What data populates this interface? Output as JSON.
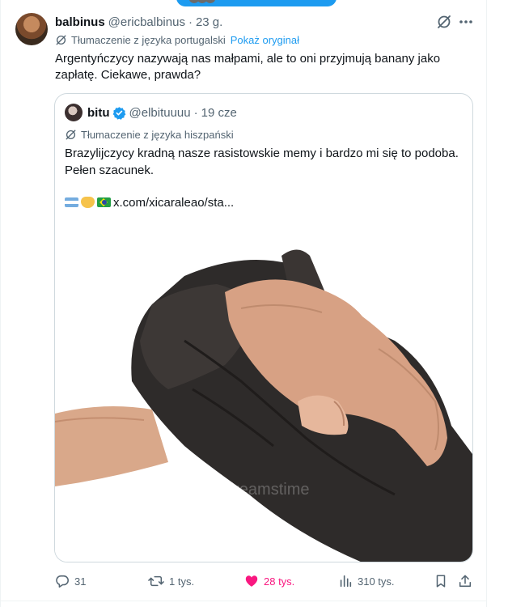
{
  "tweet": {
    "author_name": "balbinus",
    "author_handle": "@ericbalbinus",
    "separator": "·",
    "time": "23 g.",
    "translation_note": "Tłumaczenie z języka portugalski",
    "show_original": "Pokaż oryginał",
    "text": "Argentyńczycy nazywają nas małpami, ale to oni przyjmują banany jako zapłatę. Ciekawe, prawda?"
  },
  "quote": {
    "author_name": "bitu",
    "author_handle": "@elbituuuu",
    "separator": "·",
    "time": "19 cze",
    "translation_note": "Tłumaczenie z języka hiszpański",
    "text": "Brazylijczycy kradną nasze rasistowskie memy i bardzo mi się to podoba. Pełen szacunek.",
    "link": "x.com/xicaraleao/sta...",
    "image_watermark": "dreamstime"
  },
  "actions": {
    "replies": "31",
    "reposts": "1 tys.",
    "likes": "28 tys.",
    "views": "310 tys."
  },
  "colors": {
    "accent": "#1d9bf0",
    "like": "#f91880",
    "muted": "#536471",
    "text": "#0f1419"
  }
}
